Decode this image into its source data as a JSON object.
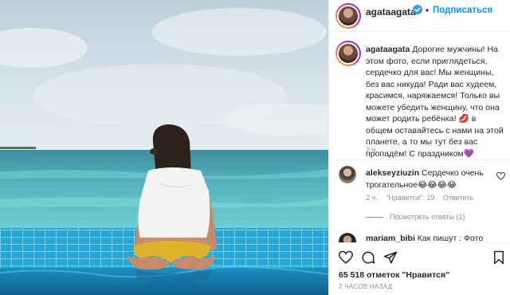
{
  "post": {
    "username": "agataagata",
    "follow_label": "Подписаться",
    "dot": "•",
    "caption_user": "agataagata",
    "caption_text": "Дорогие мужчины! На этом фото, если приглядеться, сердечко для вас! Мы женщины, без вас никуда! Ради вас худеем, красимся, наряжаемся! Только вы можете убедить женщину, что она может родить ребёнка! 💋 в общем оставайтесь с нами на этой планете, а то мы тут без вас пропадём! С праздником💜",
    "caption_time": "2 ч."
  },
  "comment": {
    "username": "alekseyziuzin",
    "text": "Сердечко очень трогательное😂😂😂😂",
    "time": "2 ч.",
    "likes": "\"Нравится\": 19",
    "reply_label": "Ответить",
    "view_replies": "Посмотреть ответы (1)"
  },
  "comment2": {
    "username": "mariam_bibi",
    "text": "Как пишут : Фото"
  },
  "actions": {
    "likes_count": "65 518 отметок \"Нравится\"",
    "post_age": "2 ЧАСОВ НАЗАД"
  },
  "icons": {
    "verified": "verified-badge-icon",
    "heart": "heart-icon",
    "comment": "comment-icon",
    "share": "share-icon",
    "save": "bookmark-icon"
  },
  "colors": {
    "accent": "#0095f6",
    "text": "#262626",
    "muted": "#8e8e8e",
    "border": "#efefef"
  }
}
